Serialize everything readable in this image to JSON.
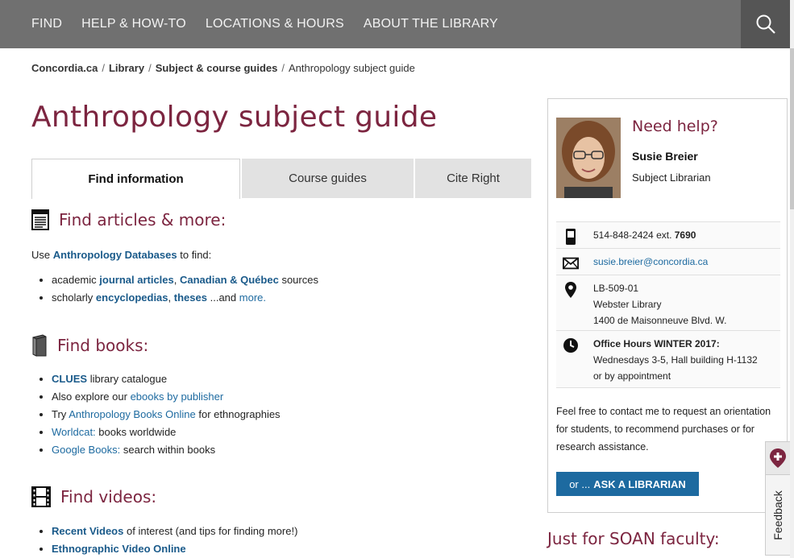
{
  "topnav": {
    "items": [
      "FIND",
      "HELP & HOW-TO",
      "LOCATIONS & HOURS",
      "ABOUT THE LIBRARY"
    ]
  },
  "breadcrumb": {
    "items": [
      "Concordia.ca",
      "Library",
      "Subject & course guides"
    ],
    "current": "Anthropology subject guide",
    "separator": "/"
  },
  "page_title": "Anthropology subject guide",
  "tabs": [
    "Find information",
    "Course guides",
    "Cite Right"
  ],
  "articles": {
    "heading": "Find articles & more:",
    "intro_before": "Use",
    "intro_link": "Anthropology Databases",
    "intro_after": "to find:",
    "bullet1": {
      "before": "academic",
      "link1": "journal articles",
      "comma": ",",
      "link2": "Canadian & Québec",
      "after": "sources"
    },
    "bullet2": {
      "before": "scholarly",
      "link1": "encyclopedias",
      "comma": ",",
      "link2": "theses",
      "middle": "...and",
      "link3": "more."
    }
  },
  "books": {
    "heading": "Find books:",
    "items": [
      {
        "link": "CLUES",
        "text": "library catalogue"
      },
      {
        "before": "Also explore our",
        "link": "ebooks by publisher"
      },
      {
        "before": "Try",
        "link": "Anthropology Books Online",
        "text": "for ethnographies"
      },
      {
        "link": "Worldcat:",
        "text": "books worldwide"
      },
      {
        "link": "Google Books:",
        "text": "search within books"
      }
    ]
  },
  "videos": {
    "heading": "Find videos:",
    "items": [
      {
        "link": "Recent Videos",
        "text": "of interest (and tips for finding more!)"
      },
      {
        "link": "Ethnographic Video Online"
      }
    ]
  },
  "sidebar": {
    "need_help": "Need help?",
    "name": "Susie Breier",
    "role": "Subject Librarian",
    "phone": "514-848-2424 ext.",
    "ext": "7690",
    "email": "susie.breier@concordia.ca",
    "address": [
      "LB-509-01",
      "Webster Library",
      "1400 de Maisonneuve Blvd. W."
    ],
    "office_title": "Office Hours WINTER 2017:",
    "office_lines": [
      "Wednesdays 3-5, Hall building H-1132",
      "or by appointment"
    ],
    "help_text": "Feel free to contact me to request an orientation for students, to recommend purchases or for research assistance.",
    "ask_prefix": "or ...",
    "ask_label": "ASK A LIBRARIAN"
  },
  "soan_heading": "Just for SOAN faculty:",
  "feedback_label": "Feedback",
  "colors": {
    "brand": "#7c2540",
    "link": "#1d6aa0",
    "nav": "#707070"
  }
}
